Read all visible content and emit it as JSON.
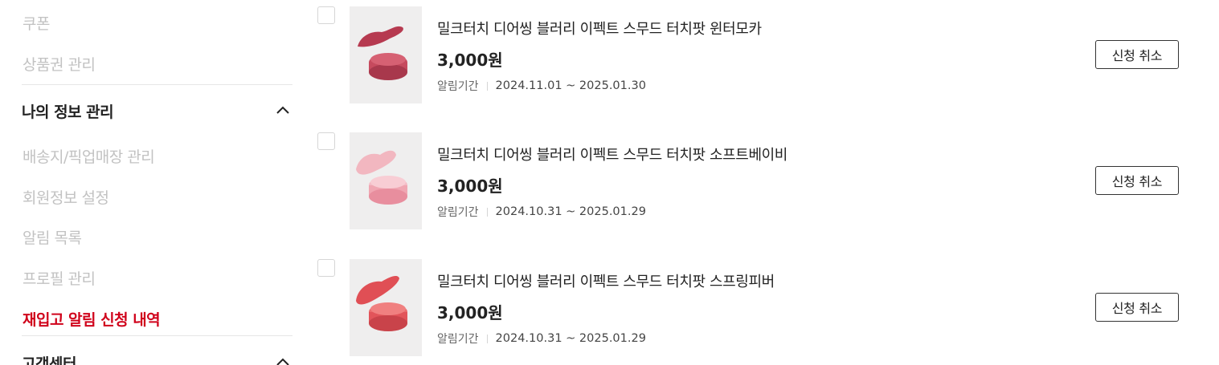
{
  "sidebar": {
    "links_top": [
      {
        "label": "쿠폰"
      },
      {
        "label": "상품권 관리"
      }
    ],
    "section_my_info": {
      "title": "나의 정보 관리",
      "icon": "chevron-up-icon"
    },
    "links_my_info": [
      {
        "label": "배송지/픽업매장 관리"
      },
      {
        "label": "회원정보 설정"
      },
      {
        "label": "알림 목록"
      },
      {
        "label": "프로필 관리"
      },
      {
        "label": "재입고 알림 신청 내역"
      }
    ],
    "section_cs": {
      "title": "고객센터",
      "icon": "chevron-up-icon"
    }
  },
  "items": [
    {
      "name": "밀크터치 디어씽 블러리 이펙트 스무드 터치팟 윈터모카",
      "price": "3,000원",
      "alert_label": "알림기간",
      "dates": "2024.11.01 ~ 2025.01.30",
      "cancel_label": "신청 취소",
      "swatch_color": "#c64a5e"
    },
    {
      "name": "밀크터치 디어씽 블러리 이펙트 스무드 터치팟 소프트베이비",
      "price": "3,000원",
      "alert_label": "알림기간",
      "dates": "2024.10.31 ~ 2025.01.29",
      "cancel_label": "신청 취소",
      "swatch_color": "#f0a6b2"
    },
    {
      "name": "밀크터치 디어씽 블러리 이펙트 스무드 터치팟 스프링피버",
      "price": "3,000원",
      "alert_label": "알림기간",
      "dates": "2024.10.31 ~ 2025.01.29",
      "cancel_label": "신청 취소",
      "swatch_color": "#e2545a"
    }
  ],
  "colors": {
    "active_menu": "#d0021b",
    "muted_menu": "#c2c2c2"
  }
}
